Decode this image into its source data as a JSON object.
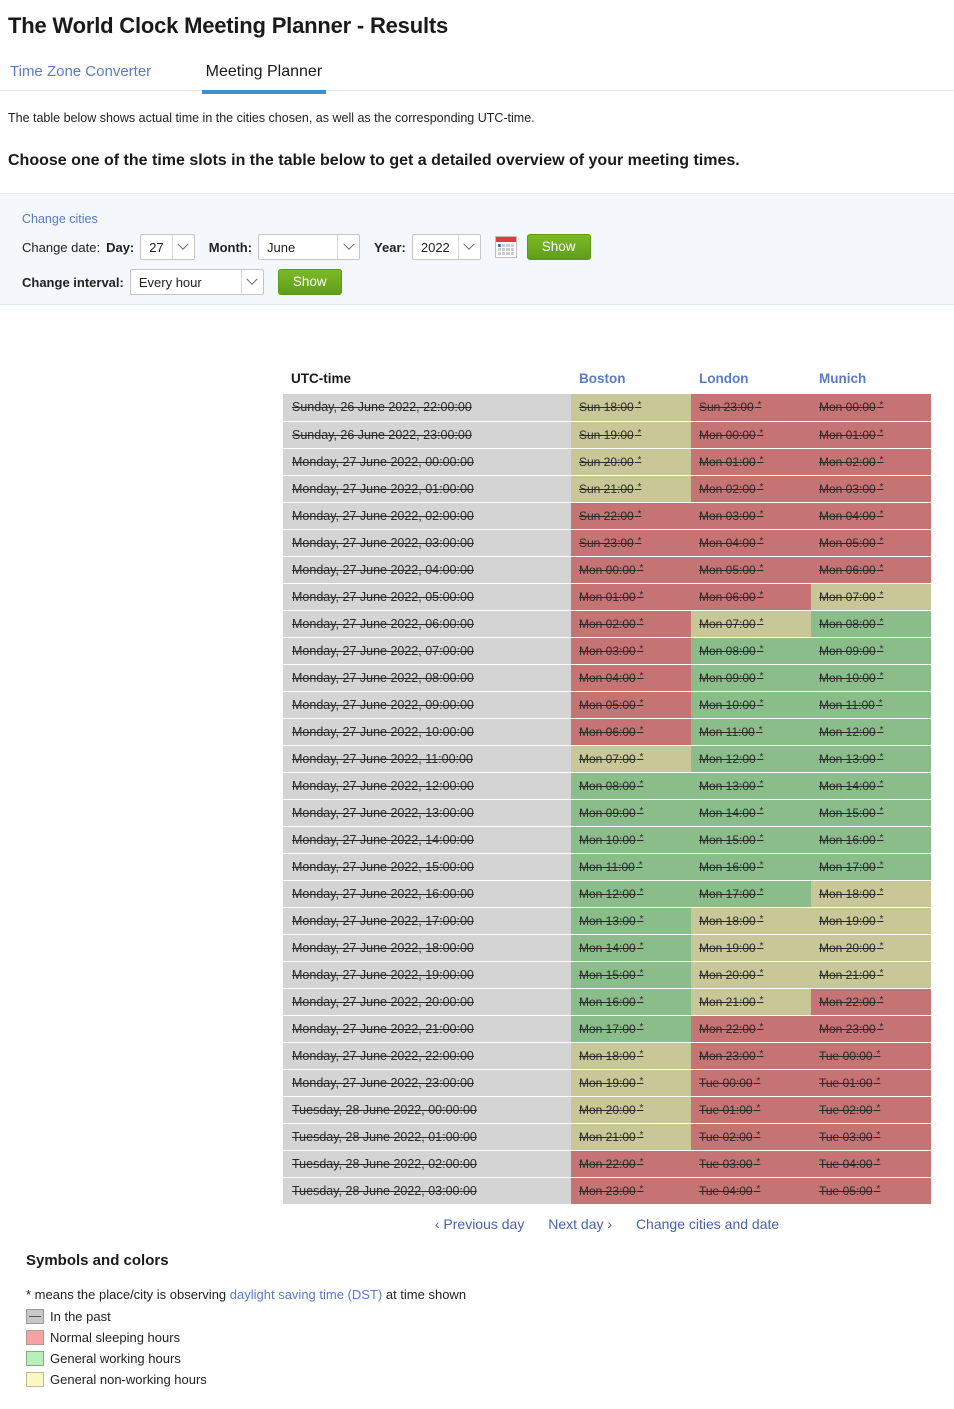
{
  "header": {
    "title": "The World Clock Meeting Planner - Results"
  },
  "tabs": [
    {
      "label": "Time Zone Converter",
      "active": false
    },
    {
      "label": "Meeting Planner",
      "active": true
    }
  ],
  "intro": "The table below shows actual time in the cities chosen, as well as the corresponding UTC-time.",
  "subhead": "Choose one of the time slots in the table below to get a detailed overview of your meeting times.",
  "controls": {
    "change_cities_link": "Change cities",
    "change_date_label": "Change date:",
    "day_label": "Day:",
    "day_value": "27",
    "month_label": "Month:",
    "month_value": "June",
    "year_label": "Year:",
    "year_value": "2022",
    "calendar_icon": "calendar-icon",
    "show_label": "Show",
    "change_interval_label": "Change interval:",
    "interval_value": "Every hour",
    "interval_show_label": "Show"
  },
  "table": {
    "columns": [
      "UTC-time",
      "Boston",
      "London",
      "Munich"
    ],
    "rows": [
      {
        "utc": "Sunday, 26 June 2022, 22:00:00",
        "cells": [
          {
            "t": "Sun 18:00",
            "dst": true,
            "k": "non"
          },
          {
            "t": "Sun 23:00",
            "dst": true,
            "k": "sleep"
          },
          {
            "t": "Mon 00:00",
            "dst": true,
            "k": "sleep"
          }
        ]
      },
      {
        "utc": "Sunday, 26 June 2022, 23:00:00",
        "cells": [
          {
            "t": "Sun 19:00",
            "dst": true,
            "k": "non"
          },
          {
            "t": "Mon 00:00",
            "dst": true,
            "k": "sleep"
          },
          {
            "t": "Mon 01:00",
            "dst": true,
            "k": "sleep"
          }
        ]
      },
      {
        "utc": "Monday, 27 June 2022, 00:00:00",
        "cells": [
          {
            "t": "Sun 20:00",
            "dst": true,
            "k": "non"
          },
          {
            "t": "Mon 01:00",
            "dst": true,
            "k": "sleep"
          },
          {
            "t": "Mon 02:00",
            "dst": true,
            "k": "sleep"
          }
        ]
      },
      {
        "utc": "Monday, 27 June 2022, 01:00:00",
        "cells": [
          {
            "t": "Sun 21:00",
            "dst": true,
            "k": "non"
          },
          {
            "t": "Mon 02:00",
            "dst": true,
            "k": "sleep"
          },
          {
            "t": "Mon 03:00",
            "dst": true,
            "k": "sleep"
          }
        ]
      },
      {
        "utc": "Monday, 27 June 2022, 02:00:00",
        "cells": [
          {
            "t": "Sun 22:00",
            "dst": true,
            "k": "sleep"
          },
          {
            "t": "Mon 03:00",
            "dst": true,
            "k": "sleep"
          },
          {
            "t": "Mon 04:00",
            "dst": true,
            "k": "sleep"
          }
        ]
      },
      {
        "utc": "Monday, 27 June 2022, 03:00:00",
        "cells": [
          {
            "t": "Sun 23:00",
            "dst": true,
            "k": "sleep"
          },
          {
            "t": "Mon 04:00",
            "dst": true,
            "k": "sleep"
          },
          {
            "t": "Mon 05:00",
            "dst": true,
            "k": "sleep"
          }
        ]
      },
      {
        "utc": "Monday, 27 June 2022, 04:00:00",
        "cells": [
          {
            "t": "Mon 00:00",
            "dst": true,
            "k": "sleep"
          },
          {
            "t": "Mon 05:00",
            "dst": true,
            "k": "sleep"
          },
          {
            "t": "Mon 06:00",
            "dst": true,
            "k": "sleep"
          }
        ]
      },
      {
        "utc": "Monday, 27 June 2022, 05:00:00",
        "cells": [
          {
            "t": "Mon 01:00",
            "dst": true,
            "k": "sleep"
          },
          {
            "t": "Mon 06:00",
            "dst": true,
            "k": "sleep"
          },
          {
            "t": "Mon 07:00",
            "dst": true,
            "k": "non"
          }
        ]
      },
      {
        "utc": "Monday, 27 June 2022, 06:00:00",
        "cells": [
          {
            "t": "Mon 02:00",
            "dst": true,
            "k": "sleep"
          },
          {
            "t": "Mon 07:00",
            "dst": true,
            "k": "non"
          },
          {
            "t": "Mon 08:00",
            "dst": true,
            "k": "work"
          }
        ]
      },
      {
        "utc": "Monday, 27 June 2022, 07:00:00",
        "cells": [
          {
            "t": "Mon 03:00",
            "dst": true,
            "k": "sleep"
          },
          {
            "t": "Mon 08:00",
            "dst": true,
            "k": "work"
          },
          {
            "t": "Mon 09:00",
            "dst": true,
            "k": "work"
          }
        ]
      },
      {
        "utc": "Monday, 27 June 2022, 08:00:00",
        "cells": [
          {
            "t": "Mon 04:00",
            "dst": true,
            "k": "sleep"
          },
          {
            "t": "Mon 09:00",
            "dst": true,
            "k": "work"
          },
          {
            "t": "Mon 10:00",
            "dst": true,
            "k": "work"
          }
        ]
      },
      {
        "utc": "Monday, 27 June 2022, 09:00:00",
        "cells": [
          {
            "t": "Mon 05:00",
            "dst": true,
            "k": "sleep"
          },
          {
            "t": "Mon 10:00",
            "dst": true,
            "k": "work"
          },
          {
            "t": "Mon 11:00",
            "dst": true,
            "k": "work"
          }
        ]
      },
      {
        "utc": "Monday, 27 June 2022, 10:00:00",
        "cells": [
          {
            "t": "Mon 06:00",
            "dst": true,
            "k": "sleep"
          },
          {
            "t": "Mon 11:00",
            "dst": true,
            "k": "work"
          },
          {
            "t": "Mon 12:00",
            "dst": true,
            "k": "work"
          }
        ]
      },
      {
        "utc": "Monday, 27 June 2022, 11:00:00",
        "cells": [
          {
            "t": "Mon 07:00",
            "dst": true,
            "k": "non"
          },
          {
            "t": "Mon 12:00",
            "dst": true,
            "k": "work"
          },
          {
            "t": "Mon 13:00",
            "dst": true,
            "k": "work"
          }
        ]
      },
      {
        "utc": "Monday, 27 June 2022, 12:00:00",
        "cells": [
          {
            "t": "Mon 08:00",
            "dst": true,
            "k": "work"
          },
          {
            "t": "Mon 13:00",
            "dst": true,
            "k": "work"
          },
          {
            "t": "Mon 14:00",
            "dst": true,
            "k": "work"
          }
        ]
      },
      {
        "utc": "Monday, 27 June 2022, 13:00:00",
        "cells": [
          {
            "t": "Mon 09:00",
            "dst": true,
            "k": "work"
          },
          {
            "t": "Mon 14:00",
            "dst": true,
            "k": "work"
          },
          {
            "t": "Mon 15:00",
            "dst": true,
            "k": "work"
          }
        ]
      },
      {
        "utc": "Monday, 27 June 2022, 14:00:00",
        "cells": [
          {
            "t": "Mon 10:00",
            "dst": true,
            "k": "work"
          },
          {
            "t": "Mon 15:00",
            "dst": true,
            "k": "work"
          },
          {
            "t": "Mon 16:00",
            "dst": true,
            "k": "work"
          }
        ]
      },
      {
        "utc": "Monday, 27 June 2022, 15:00:00",
        "cells": [
          {
            "t": "Mon 11:00",
            "dst": true,
            "k": "work"
          },
          {
            "t": "Mon 16:00",
            "dst": true,
            "k": "work"
          },
          {
            "t": "Mon 17:00",
            "dst": true,
            "k": "work"
          }
        ]
      },
      {
        "utc": "Monday, 27 June 2022, 16:00:00",
        "cells": [
          {
            "t": "Mon 12:00",
            "dst": true,
            "k": "work"
          },
          {
            "t": "Mon 17:00",
            "dst": true,
            "k": "work"
          },
          {
            "t": "Mon 18:00",
            "dst": true,
            "k": "non"
          }
        ]
      },
      {
        "utc": "Monday, 27 June 2022, 17:00:00",
        "cells": [
          {
            "t": "Mon 13:00",
            "dst": true,
            "k": "work"
          },
          {
            "t": "Mon 18:00",
            "dst": true,
            "k": "non"
          },
          {
            "t": "Mon 19:00",
            "dst": true,
            "k": "non"
          }
        ]
      },
      {
        "utc": "Monday, 27 June 2022, 18:00:00",
        "cells": [
          {
            "t": "Mon 14:00",
            "dst": true,
            "k": "work"
          },
          {
            "t": "Mon 19:00",
            "dst": true,
            "k": "non"
          },
          {
            "t": "Mon 20:00",
            "dst": true,
            "k": "non"
          }
        ]
      },
      {
        "utc": "Monday, 27 June 2022, 19:00:00",
        "cells": [
          {
            "t": "Mon 15:00",
            "dst": true,
            "k": "work"
          },
          {
            "t": "Mon 20:00",
            "dst": true,
            "k": "non"
          },
          {
            "t": "Mon 21:00",
            "dst": true,
            "k": "non"
          }
        ]
      },
      {
        "utc": "Monday, 27 June 2022, 20:00:00",
        "cells": [
          {
            "t": "Mon 16:00",
            "dst": true,
            "k": "work"
          },
          {
            "t": "Mon 21:00",
            "dst": true,
            "k": "non"
          },
          {
            "t": "Mon 22:00",
            "dst": true,
            "k": "sleep"
          }
        ]
      },
      {
        "utc": "Monday, 27 June 2022, 21:00:00",
        "cells": [
          {
            "t": "Mon 17:00",
            "dst": true,
            "k": "work"
          },
          {
            "t": "Mon 22:00",
            "dst": true,
            "k": "sleep"
          },
          {
            "t": "Mon 23:00",
            "dst": true,
            "k": "sleep"
          }
        ]
      },
      {
        "utc": "Monday, 27 June 2022, 22:00:00",
        "cells": [
          {
            "t": "Mon 18:00",
            "dst": true,
            "k": "non"
          },
          {
            "t": "Mon 23:00",
            "dst": true,
            "k": "sleep"
          },
          {
            "t": "Tue 00:00",
            "dst": true,
            "k": "sleep"
          }
        ]
      },
      {
        "utc": "Monday, 27 June 2022, 23:00:00",
        "cells": [
          {
            "t": "Mon 19:00",
            "dst": true,
            "k": "non"
          },
          {
            "t": "Tue 00:00",
            "dst": true,
            "k": "sleep"
          },
          {
            "t": "Tue 01:00",
            "dst": true,
            "k": "sleep"
          }
        ]
      },
      {
        "utc": "Tuesday, 28 June 2022, 00:00:00",
        "cells": [
          {
            "t": "Mon 20:00",
            "dst": true,
            "k": "non"
          },
          {
            "t": "Tue 01:00",
            "dst": true,
            "k": "sleep"
          },
          {
            "t": "Tue 02:00",
            "dst": true,
            "k": "sleep"
          }
        ]
      },
      {
        "utc": "Tuesday, 28 June 2022, 01:00:00",
        "cells": [
          {
            "t": "Mon 21:00",
            "dst": true,
            "k": "non"
          },
          {
            "t": "Tue 02:00",
            "dst": true,
            "k": "sleep"
          },
          {
            "t": "Tue 03:00",
            "dst": true,
            "k": "sleep"
          }
        ]
      },
      {
        "utc": "Tuesday, 28 June 2022, 02:00:00",
        "cells": [
          {
            "t": "Mon 22:00",
            "dst": true,
            "k": "sleep"
          },
          {
            "t": "Tue 03:00",
            "dst": true,
            "k": "sleep"
          },
          {
            "t": "Tue 04:00",
            "dst": true,
            "k": "sleep"
          }
        ]
      },
      {
        "utc": "Tuesday, 28 June 2022, 03:00:00",
        "cells": [
          {
            "t": "Mon 23:00",
            "dst": true,
            "k": "sleep"
          },
          {
            "t": "Tue 04:00",
            "dst": true,
            "k": "sleep"
          },
          {
            "t": "Tue 05:00",
            "dst": true,
            "k": "sleep"
          }
        ]
      }
    ]
  },
  "table_nav": {
    "prev_arrow": "‹",
    "prev_label": "Previous day",
    "next_label": "Next day",
    "next_arrow": "›",
    "change_label": "Change cities and date"
  },
  "legend": {
    "title": "Symbols and colors",
    "dst_prefix": "* means the place/city is observing ",
    "dst_link": "daylight saving time (DST)",
    "dst_suffix": " at time shown",
    "items": [
      {
        "label": "In the past",
        "swatch": "past",
        "color": "#c8c8c8"
      },
      {
        "label": "Normal sleeping hours",
        "swatch": "sleep",
        "color": "#f7a1a1"
      },
      {
        "label": "General working hours",
        "swatch": "work",
        "color": "#b9f0b9"
      },
      {
        "label": "General non-working hours",
        "swatch": "non",
        "color": "#f8f8c0"
      }
    ]
  },
  "colors": {
    "accent_tab": "#3e8ecc",
    "link": "#5b7bc4",
    "cell_sleep": "#c57373",
    "cell_work": "#8bbd8b",
    "cell_nonwork": "#c7c797",
    "cell_past_utc": "#d4d4d4",
    "button_green": "#6faf1e"
  }
}
